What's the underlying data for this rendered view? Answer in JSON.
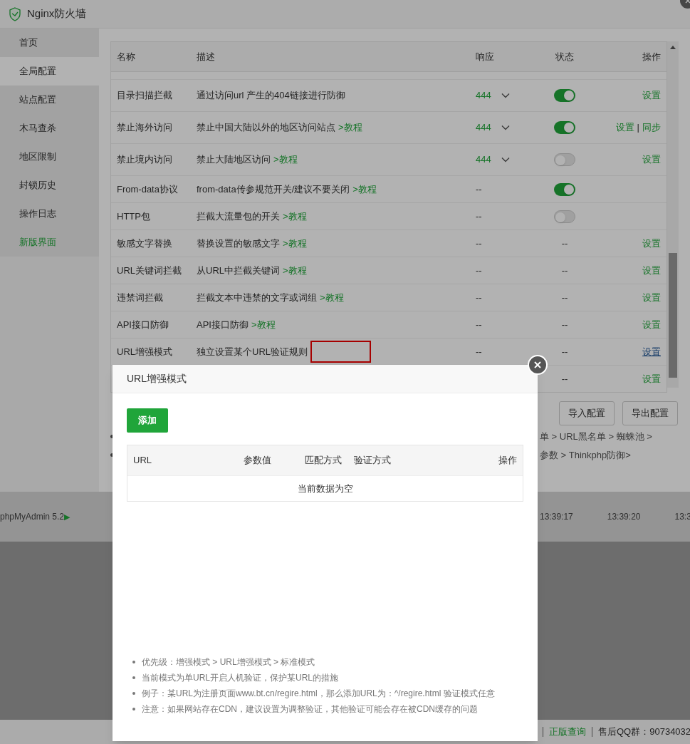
{
  "window": {
    "title": "Nginx防火墙"
  },
  "sidebar": {
    "items": [
      {
        "label": "首页",
        "selected": false,
        "kind": "normal"
      },
      {
        "label": "全局配置",
        "selected": true,
        "kind": "normal"
      },
      {
        "label": "站点配置",
        "selected": false,
        "kind": "normal"
      },
      {
        "label": "木马查杀",
        "selected": false,
        "kind": "normal"
      },
      {
        "label": "地区限制",
        "selected": false,
        "kind": "normal"
      },
      {
        "label": "封锁历史",
        "selected": false,
        "kind": "normal"
      },
      {
        "label": "操作日志",
        "selected": false,
        "kind": "normal"
      },
      {
        "label": "新版界面",
        "selected": false,
        "kind": "highlight"
      }
    ]
  },
  "table": {
    "columns": [
      "名称",
      "描述",
      "响应",
      "状态",
      "操作"
    ],
    "rows": [
      {
        "name": "目录扫描拦截",
        "description": "通过访问url 产生的404链接进行防御",
        "response": {
          "value": "444",
          "dropdown": true
        },
        "status": {
          "kind": "toggle",
          "on": true
        },
        "actions": [
          {
            "label": "设置",
            "underlined": false
          }
        ]
      },
      {
        "name": "禁止海外访问",
        "description": "禁止中国大陆以外的地区访问站点",
        "link": ">教程",
        "response": {
          "value": "444",
          "dropdown": true
        },
        "status": {
          "kind": "toggle",
          "on": true
        },
        "actions": [
          {
            "label": "设置",
            "underlined": false
          },
          {
            "label": "同步",
            "underlined": false
          }
        ],
        "separator": "|"
      },
      {
        "name": "禁止境内访问",
        "description": "禁止大陆地区访问",
        "link": ">教程",
        "response": {
          "value": "444",
          "dropdown": true
        },
        "status": {
          "kind": "toggle",
          "on": false
        },
        "actions": [
          {
            "label": "设置",
            "underlined": false
          }
        ]
      },
      {
        "name": "From-data协议",
        "description": "from-data传参规范开关/建议不要关闭",
        "link": ">教程",
        "response": {
          "value": "--",
          "dropdown": false
        },
        "status": {
          "kind": "toggle",
          "on": true
        },
        "actions": []
      },
      {
        "name": "HTTP包",
        "description": "拦截大流量包的开关",
        "link": ">教程",
        "response": {
          "value": "--",
          "dropdown": false
        },
        "status": {
          "kind": "toggle",
          "on": false
        },
        "actions": []
      },
      {
        "name": "敏感文字替换",
        "description": "替换设置的敏感文字",
        "link": ">教程",
        "response": {
          "value": "--",
          "dropdown": false
        },
        "status": {
          "kind": "text",
          "text": "--"
        },
        "actions": [
          {
            "label": "设置",
            "underlined": false
          }
        ]
      },
      {
        "name": "URL关键词拦截",
        "description": "从URL中拦截关键词",
        "link": ">教程",
        "response": {
          "value": "--",
          "dropdown": false
        },
        "status": {
          "kind": "text",
          "text": "--"
        },
        "actions": [
          {
            "label": "设置",
            "underlined": false
          }
        ]
      },
      {
        "name": "违禁词拦截",
        "description": "拦截文本中违禁的文字或词组",
        "link": ">教程",
        "response": {
          "value": "--",
          "dropdown": false
        },
        "status": {
          "kind": "text",
          "text": "--"
        },
        "actions": [
          {
            "label": "设置",
            "underlined": false
          }
        ]
      },
      {
        "name": "API接口防御",
        "description": "API接口防御",
        "link": ">教程",
        "response": {
          "value": "--",
          "dropdown": false
        },
        "status": {
          "kind": "text",
          "text": "--"
        },
        "actions": [
          {
            "label": "设置",
            "underlined": false
          }
        ]
      },
      {
        "name": "URL增强模式",
        "description": "独立设置某个URL验证规则",
        "highlighted": true,
        "response": {
          "value": "--",
          "dropdown": false
        },
        "status": {
          "kind": "text",
          "text": "--"
        },
        "actions": [
          {
            "label": "设置",
            "underlined": true
          }
        ]
      },
      {
        "status": {
          "kind": "text",
          "text": "--"
        },
        "actions": [
          {
            "label": "设置",
            "underlined": false
          }
        ]
      }
    ]
  },
  "buttons": [
    "导入配置",
    "导出配置"
  ],
  "notes": [
    "单 > URL黑名单 > 蜘蛛池 >",
    "参数 > Thinkphp防御>"
  ],
  "background": {
    "app_label": "phpMyAdmin 5.2",
    "app_arrow": "▶",
    "times": [
      "13:39:17",
      "13:39:20",
      "13:3"
    ],
    "footer": [
      "正版查询",
      "售后QQ群：90734032"
    ]
  },
  "dialog": {
    "title": "URL增强模式",
    "add_button": "添加",
    "columns": [
      "URL",
      "参数值",
      "匹配方式",
      "验证方式",
      "操作"
    ],
    "empty_text": "当前数据为空",
    "notes": [
      "优先级：增强模式 > URL增强模式 > 标准模式",
      "当前模式为单URL开启人机验证，保护某URL的措施",
      "例子：某URL为注册页面www.bt.cn/regire.html，那么添加URL为：^/regire.html 验证模式任意",
      "注意：如果网站存在CDN，建议设置为调整验证，其他验证可能会存在被CDN缓存的问题"
    ]
  }
}
